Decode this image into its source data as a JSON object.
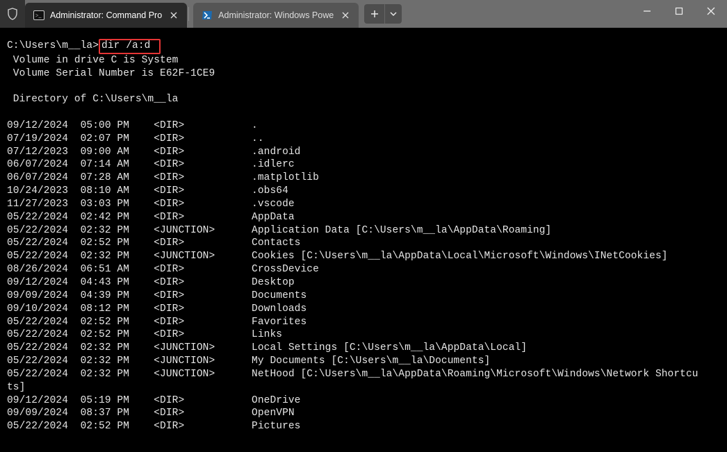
{
  "tabs": {
    "active": {
      "label": "Administrator: Command Pro"
    },
    "inactive": {
      "label": "Administrator: Windows Powe"
    }
  },
  "prompt": {
    "path": "C:\\Users\\m__la>",
    "command": "dir /a:d"
  },
  "header": {
    "l1": " Volume in drive C is System",
    "l2": " Volume Serial Number is E62F-1CE9",
    "l3": " Directory of C:\\Users\\m__la"
  },
  "rows": [
    {
      "d": "09/12/2024",
      "t": "05:00 PM",
      "ty": "<DIR>",
      "n": "."
    },
    {
      "d": "07/19/2024",
      "t": "02:07 PM",
      "ty": "<DIR>",
      "n": ".."
    },
    {
      "d": "07/12/2023",
      "t": "09:00 AM",
      "ty": "<DIR>",
      "n": ".android"
    },
    {
      "d": "06/07/2024",
      "t": "07:14 AM",
      "ty": "<DIR>",
      "n": ".idlerc"
    },
    {
      "d": "06/07/2024",
      "t": "07:28 AM",
      "ty": "<DIR>",
      "n": ".matplotlib"
    },
    {
      "d": "10/24/2023",
      "t": "08:10 AM",
      "ty": "<DIR>",
      "n": ".obs64"
    },
    {
      "d": "11/27/2023",
      "t": "03:03 PM",
      "ty": "<DIR>",
      "n": ".vscode"
    },
    {
      "d": "05/22/2024",
      "t": "02:42 PM",
      "ty": "<DIR>",
      "n": "AppData"
    },
    {
      "d": "05/22/2024",
      "t": "02:32 PM",
      "ty": "<JUNCTION>",
      "n": "Application Data [C:\\Users\\m__la\\AppData\\Roaming]"
    },
    {
      "d": "05/22/2024",
      "t": "02:52 PM",
      "ty": "<DIR>",
      "n": "Contacts"
    },
    {
      "d": "05/22/2024",
      "t": "02:32 PM",
      "ty": "<JUNCTION>",
      "n": "Cookies [C:\\Users\\m__la\\AppData\\Local\\Microsoft\\Windows\\INetCookies]"
    },
    {
      "d": "08/26/2024",
      "t": "06:51 AM",
      "ty": "<DIR>",
      "n": "CrossDevice"
    },
    {
      "d": "09/12/2024",
      "t": "04:43 PM",
      "ty": "<DIR>",
      "n": "Desktop"
    },
    {
      "d": "09/09/2024",
      "t": "04:39 PM",
      "ty": "<DIR>",
      "n": "Documents"
    },
    {
      "d": "09/10/2024",
      "t": "08:12 PM",
      "ty": "<DIR>",
      "n": "Downloads"
    },
    {
      "d": "05/22/2024",
      "t": "02:52 PM",
      "ty": "<DIR>",
      "n": "Favorites"
    },
    {
      "d": "05/22/2024",
      "t": "02:52 PM",
      "ty": "<DIR>",
      "n": "Links"
    },
    {
      "d": "05/22/2024",
      "t": "02:32 PM",
      "ty": "<JUNCTION>",
      "n": "Local Settings [C:\\Users\\m__la\\AppData\\Local]"
    },
    {
      "d": "05/22/2024",
      "t": "02:32 PM",
      "ty": "<JUNCTION>",
      "n": "My Documents [C:\\Users\\m__la\\Documents]"
    },
    {
      "d": "05/22/2024",
      "t": "02:32 PM",
      "ty": "<JUNCTION>",
      "n": "NetHood [C:\\Users\\m__la\\AppData\\Roaming\\Microsoft\\Windows\\Network Shortcu",
      "wrap": "ts]"
    },
    {
      "d": "09/12/2024",
      "t": "05:19 PM",
      "ty": "<DIR>",
      "n": "OneDrive"
    },
    {
      "d": "09/09/2024",
      "t": "08:37 PM",
      "ty": "<DIR>",
      "n": "OpenVPN"
    },
    {
      "d": "05/22/2024",
      "t": "02:52 PM",
      "ty": "<DIR>",
      "n": "Pictures"
    }
  ]
}
